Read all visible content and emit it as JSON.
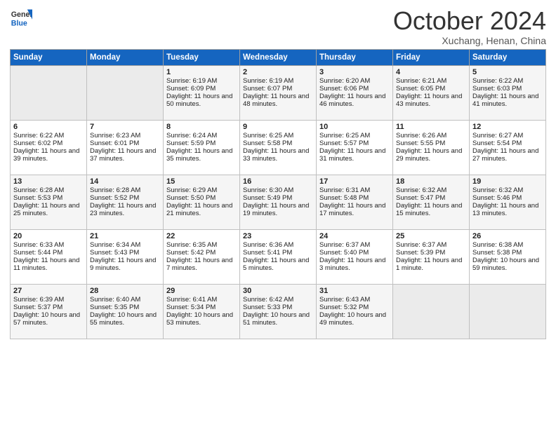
{
  "header": {
    "logo_general": "General",
    "logo_blue": "Blue",
    "month": "October 2024",
    "location": "Xuchang, Henan, China"
  },
  "days_of_week": [
    "Sunday",
    "Monday",
    "Tuesday",
    "Wednesday",
    "Thursday",
    "Friday",
    "Saturday"
  ],
  "weeks": [
    [
      {
        "day": "",
        "info": ""
      },
      {
        "day": "",
        "info": ""
      },
      {
        "day": "1",
        "info": "Sunrise: 6:19 AM\nSunset: 6:09 PM\nDaylight: 11 hours and 50 minutes."
      },
      {
        "day": "2",
        "info": "Sunrise: 6:19 AM\nSunset: 6:07 PM\nDaylight: 11 hours and 48 minutes."
      },
      {
        "day": "3",
        "info": "Sunrise: 6:20 AM\nSunset: 6:06 PM\nDaylight: 11 hours and 46 minutes."
      },
      {
        "day": "4",
        "info": "Sunrise: 6:21 AM\nSunset: 6:05 PM\nDaylight: 11 hours and 43 minutes."
      },
      {
        "day": "5",
        "info": "Sunrise: 6:22 AM\nSunset: 6:03 PM\nDaylight: 11 hours and 41 minutes."
      }
    ],
    [
      {
        "day": "6",
        "info": "Sunrise: 6:22 AM\nSunset: 6:02 PM\nDaylight: 11 hours and 39 minutes."
      },
      {
        "day": "7",
        "info": "Sunrise: 6:23 AM\nSunset: 6:01 PM\nDaylight: 11 hours and 37 minutes."
      },
      {
        "day": "8",
        "info": "Sunrise: 6:24 AM\nSunset: 5:59 PM\nDaylight: 11 hours and 35 minutes."
      },
      {
        "day": "9",
        "info": "Sunrise: 6:25 AM\nSunset: 5:58 PM\nDaylight: 11 hours and 33 minutes."
      },
      {
        "day": "10",
        "info": "Sunrise: 6:25 AM\nSunset: 5:57 PM\nDaylight: 11 hours and 31 minutes."
      },
      {
        "day": "11",
        "info": "Sunrise: 6:26 AM\nSunset: 5:55 PM\nDaylight: 11 hours and 29 minutes."
      },
      {
        "day": "12",
        "info": "Sunrise: 6:27 AM\nSunset: 5:54 PM\nDaylight: 11 hours and 27 minutes."
      }
    ],
    [
      {
        "day": "13",
        "info": "Sunrise: 6:28 AM\nSunset: 5:53 PM\nDaylight: 11 hours and 25 minutes."
      },
      {
        "day": "14",
        "info": "Sunrise: 6:28 AM\nSunset: 5:52 PM\nDaylight: 11 hours and 23 minutes."
      },
      {
        "day": "15",
        "info": "Sunrise: 6:29 AM\nSunset: 5:50 PM\nDaylight: 11 hours and 21 minutes."
      },
      {
        "day": "16",
        "info": "Sunrise: 6:30 AM\nSunset: 5:49 PM\nDaylight: 11 hours and 19 minutes."
      },
      {
        "day": "17",
        "info": "Sunrise: 6:31 AM\nSunset: 5:48 PM\nDaylight: 11 hours and 17 minutes."
      },
      {
        "day": "18",
        "info": "Sunrise: 6:32 AM\nSunset: 5:47 PM\nDaylight: 11 hours and 15 minutes."
      },
      {
        "day": "19",
        "info": "Sunrise: 6:32 AM\nSunset: 5:46 PM\nDaylight: 11 hours and 13 minutes."
      }
    ],
    [
      {
        "day": "20",
        "info": "Sunrise: 6:33 AM\nSunset: 5:44 PM\nDaylight: 11 hours and 11 minutes."
      },
      {
        "day": "21",
        "info": "Sunrise: 6:34 AM\nSunset: 5:43 PM\nDaylight: 11 hours and 9 minutes."
      },
      {
        "day": "22",
        "info": "Sunrise: 6:35 AM\nSunset: 5:42 PM\nDaylight: 11 hours and 7 minutes."
      },
      {
        "day": "23",
        "info": "Sunrise: 6:36 AM\nSunset: 5:41 PM\nDaylight: 11 hours and 5 minutes."
      },
      {
        "day": "24",
        "info": "Sunrise: 6:37 AM\nSunset: 5:40 PM\nDaylight: 11 hours and 3 minutes."
      },
      {
        "day": "25",
        "info": "Sunrise: 6:37 AM\nSunset: 5:39 PM\nDaylight: 11 hours and 1 minute."
      },
      {
        "day": "26",
        "info": "Sunrise: 6:38 AM\nSunset: 5:38 PM\nDaylight: 10 hours and 59 minutes."
      }
    ],
    [
      {
        "day": "27",
        "info": "Sunrise: 6:39 AM\nSunset: 5:37 PM\nDaylight: 10 hours and 57 minutes."
      },
      {
        "day": "28",
        "info": "Sunrise: 6:40 AM\nSunset: 5:35 PM\nDaylight: 10 hours and 55 minutes."
      },
      {
        "day": "29",
        "info": "Sunrise: 6:41 AM\nSunset: 5:34 PM\nDaylight: 10 hours and 53 minutes."
      },
      {
        "day": "30",
        "info": "Sunrise: 6:42 AM\nSunset: 5:33 PM\nDaylight: 10 hours and 51 minutes."
      },
      {
        "day": "31",
        "info": "Sunrise: 6:43 AM\nSunset: 5:32 PM\nDaylight: 10 hours and 49 minutes."
      },
      {
        "day": "",
        "info": ""
      },
      {
        "day": "",
        "info": ""
      }
    ]
  ]
}
